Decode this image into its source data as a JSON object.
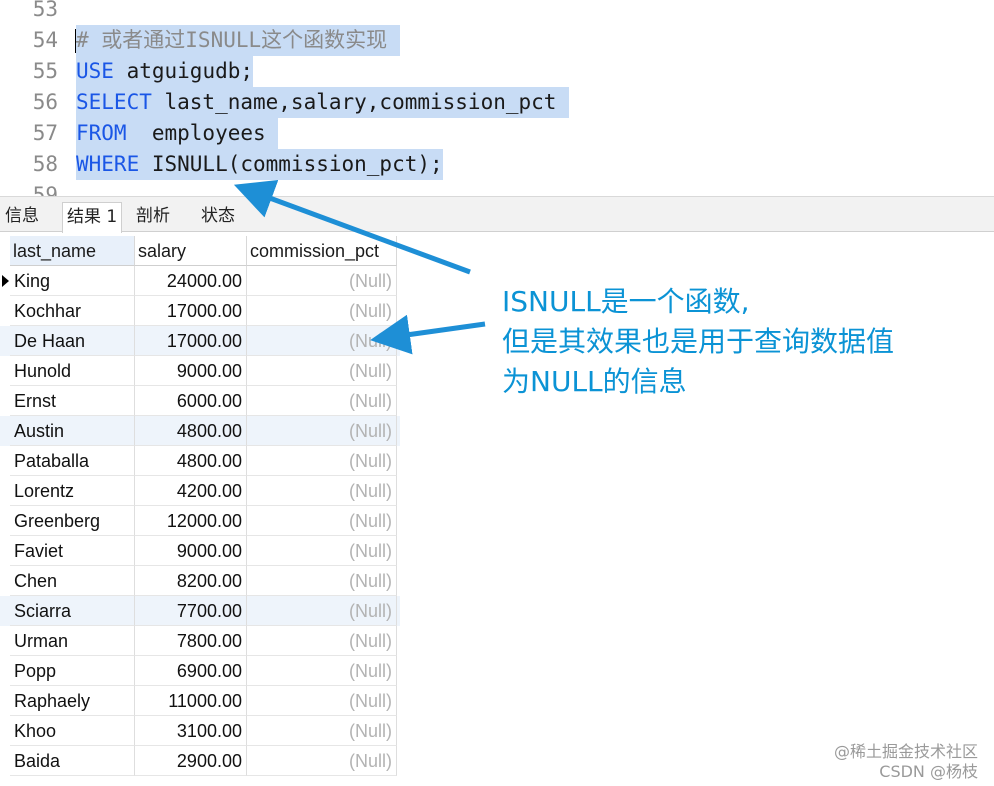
{
  "editor": {
    "lines": [
      {
        "num": "53",
        "text": "",
        "selected": false
      },
      {
        "num": "54",
        "comment": "# 或者通过ISNULL这个函数实现",
        "selected": true
      },
      {
        "num": "55",
        "keyword": "USE",
        "text": " atguigudb;",
        "selected": true
      },
      {
        "num": "56",
        "keyword": "SELECT",
        "text": " last_name,salary,commission_pct ",
        "selected": true
      },
      {
        "num": "57",
        "keyword": "FROM",
        "text": "  employees ",
        "selected": true
      },
      {
        "num": "58",
        "keyword": "WHERE",
        "text": " ISNULL(commission_pct);",
        "selected": true
      },
      {
        "num": "59",
        "text": "",
        "selected": false
      }
    ]
  },
  "result_tabs": [
    {
      "label": "信息",
      "active": false
    },
    {
      "label": "结果 1",
      "active": true
    },
    {
      "label": "剖析",
      "active": false
    },
    {
      "label": "状态",
      "active": false
    }
  ],
  "grid": {
    "columns": [
      "last_name",
      "salary",
      "commission_pct"
    ],
    "rows": [
      {
        "last_name": "King",
        "salary": "24000.00",
        "commission_pct": "(Null)"
      },
      {
        "last_name": "Kochhar",
        "salary": "17000.00",
        "commission_pct": "(Null)"
      },
      {
        "last_name": "De Haan",
        "salary": "17000.00",
        "commission_pct": "(Null)"
      },
      {
        "last_name": "Hunold",
        "salary": "9000.00",
        "commission_pct": "(Null)"
      },
      {
        "last_name": "Ernst",
        "salary": "6000.00",
        "commission_pct": "(Null)"
      },
      {
        "last_name": "Austin",
        "salary": "4800.00",
        "commission_pct": "(Null)"
      },
      {
        "last_name": "Pataballa",
        "salary": "4800.00",
        "commission_pct": "(Null)"
      },
      {
        "last_name": "Lorentz",
        "salary": "4200.00",
        "commission_pct": "(Null)"
      },
      {
        "last_name": "Greenberg",
        "salary": "12000.00",
        "commission_pct": "(Null)"
      },
      {
        "last_name": "Faviet",
        "salary": "9000.00",
        "commission_pct": "(Null)"
      },
      {
        "last_name": "Chen",
        "salary": "8200.00",
        "commission_pct": "(Null)"
      },
      {
        "last_name": "Sciarra",
        "salary": "7700.00",
        "commission_pct": "(Null)"
      },
      {
        "last_name": "Urman",
        "salary": "7800.00",
        "commission_pct": "(Null)"
      },
      {
        "last_name": "Popp",
        "salary": "6900.00",
        "commission_pct": "(Null)"
      },
      {
        "last_name": "Raphaely",
        "salary": "11000.00",
        "commission_pct": "(Null)"
      },
      {
        "last_name": "Khoo",
        "salary": "3100.00",
        "commission_pct": "(Null)"
      },
      {
        "last_name": "Baida",
        "salary": "2900.00",
        "commission_pct": "(Null)"
      }
    ]
  },
  "annotation": {
    "lines": [
      "ISNULL是一个函数,",
      "但是其效果也是用于查询数据值",
      "为NULL的信息"
    ],
    "color": "#0b93d5"
  },
  "watermark": {
    "line1": "@稀土掘金技术社区",
    "line2": "CSDN @杨枝"
  },
  "colors": {
    "keyword": "#1a56e6",
    "selection": "#c8dcf5",
    "null_text": "#b3b3b3"
  }
}
